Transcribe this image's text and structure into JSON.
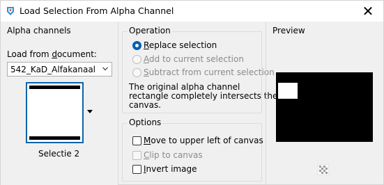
{
  "window": {
    "title": "Load Selection From Alpha Channel",
    "close_label": "✕",
    "app_icon": "psp-palette-icon"
  },
  "left": {
    "header": "Alpha channels",
    "load_label_prefix": "Load from ",
    "load_label_underlined": "d",
    "load_label_suffix": "ocument:",
    "document_select_value": "542_KaD_Alfakanaal",
    "channel_name": "Selectie 2"
  },
  "operation": {
    "header": "Operation",
    "options": [
      {
        "accel": "R",
        "rest": "eplace selection",
        "selected": true,
        "enabled": true
      },
      {
        "accel": "A",
        "rest": "dd to current selection",
        "selected": false,
        "enabled": false
      },
      {
        "accel": "S",
        "rest": "ubtract from current selection",
        "selected": false,
        "enabled": false
      }
    ],
    "message_line1": "The original alpha channel",
    "message_line2": "rectangle completely intersects the",
    "message_line3": "canvas."
  },
  "options": {
    "header": "Options",
    "items": [
      {
        "accel": "M",
        "rest": "ove to upper left of canvas",
        "checked": false,
        "enabled": true
      },
      {
        "pre": "",
        "accel": "C",
        "rest": "lip to canvas",
        "checked": false,
        "enabled": false
      },
      {
        "accel": "I",
        "rest": "nvert image",
        "checked": false,
        "enabled": true
      }
    ]
  },
  "preview": {
    "header": "Preview",
    "toggle_icon": "transparency-checker-icon"
  }
}
